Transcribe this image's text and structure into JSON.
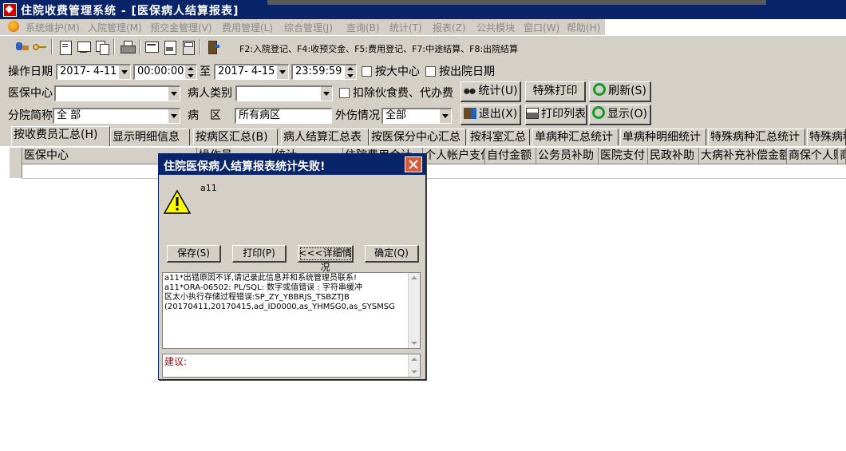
{
  "window": {
    "title": "住院收费管理系统 - [医保病人结算报表]"
  },
  "menu": {
    "items": [
      "系统维护(M)",
      "入院管理(M)",
      "预交金管理(V)",
      "费用管理(L)",
      "综合管理(J)",
      "查询(B)",
      "统计(T)",
      "报表(Z)",
      "公共模块",
      "窗口(W)",
      "帮助(H)"
    ]
  },
  "toolbar": {
    "shortcuts": "F2:入院登记、F4:收预交金、F5:费用登记、F7:中途结算、F8:出院结算"
  },
  "filters": {
    "op_date_label": "操作日期",
    "date_from": "2017- 4-11",
    "time_from": "00:00:00",
    "to_label": "至",
    "date_to": "2017- 4-15",
    "time_to": "23:59:59",
    "by_center_label": "按大中心",
    "by_discharge_label": "按出院日期",
    "insurance_center_label": "医保中心",
    "insurance_center_value": "",
    "patient_type_label": "病人类别",
    "patient_type_value": "",
    "exclude_label": "扣除伙食费、代办费",
    "branch_label": "分院简称",
    "branch_value": "全 部",
    "ward_label": "病　区",
    "ward_value": "所有病区",
    "injury_label": "外伤情况",
    "injury_value": "全部"
  },
  "buttons": {
    "stat": "统计(U)",
    "special_print": "特殊打印",
    "refresh": "刷新(S)",
    "exit": "退出(X)",
    "print_list": "打印列表",
    "display": "显示(O)"
  },
  "tabs": [
    "按收费员汇总(H)",
    "显示明细信息",
    "按病区汇总(B)",
    "病人结算汇总表",
    "按医保分中心汇总",
    "按科室汇总",
    "单病种汇总统计",
    "单病种明细统计",
    "特殊病种汇总统计",
    "特殊病种"
  ],
  "grid": {
    "columns": [
      "医保中心",
      "操作员",
      "统计...",
      "住院费用合计",
      "个人帐户支付",
      "自付金额",
      "公务员补助",
      "医院支付",
      "民政补助",
      "大病补充补偿金额",
      "商保个人赔",
      "商"
    ]
  },
  "dialog": {
    "title": "住院医保病人结算报表统计失败!",
    "message": "a11",
    "btn_save": "保存(S)",
    "btn_print": "打印(P)",
    "btn_detail": "<<<详细情况",
    "btn_ok": "确定(Q)",
    "detail_lines": [
      "a11*出错原因不详,请记录此信息并和系统管理员联系!",
      "a11*ORA-06502: PL/SQL: 数字或值错误 :  字符串缓冲",
      "区太小执行存储过程错误:SP_ZY_YBBRJS_TSBZTJB",
      "(20170411,20170415,ad_ID0000,as_YHMSG0,as_SYSMSG"
    ],
    "suggest_label": "建议:"
  }
}
